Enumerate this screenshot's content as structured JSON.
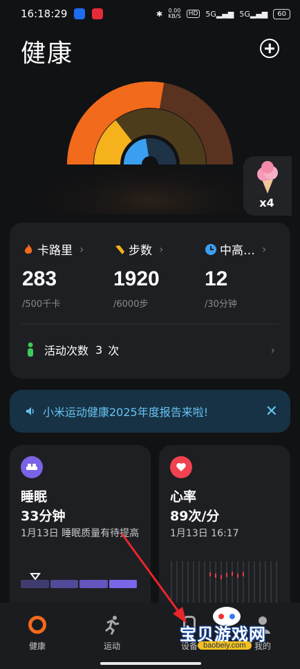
{
  "status_bar": {
    "time": "16:18:29",
    "net_speed_value": "0.00",
    "net_speed_unit": "KB/S",
    "hd_badge": "HD",
    "sig1": "5G",
    "sig2": "5G",
    "battery": "60"
  },
  "header": {
    "title": "健康"
  },
  "badge": {
    "count": "x4"
  },
  "stats": {
    "calories": {
      "label": "卡路里",
      "value": "283",
      "goal": "/500千卡"
    },
    "steps": {
      "label": "步数",
      "value": "1920",
      "goal": "/6000步"
    },
    "intensity": {
      "label": "中高…",
      "value": "12",
      "goal": "/30分钟"
    },
    "activity": {
      "label": "活动次数",
      "count": "3",
      "unit": "次"
    }
  },
  "banner": {
    "text": "小米运动健康2025年度报告来啦!"
  },
  "sleep": {
    "title": "睡眠",
    "value": "33分钟",
    "sub": "1月13日 睡眠质量有待提高"
  },
  "heart_rate": {
    "title": "心率",
    "value": "89次/分",
    "sub": "1月13日 16:17"
  },
  "nav": {
    "health": "健康",
    "workout": "运动",
    "devices": "设备",
    "mine": "我的"
  },
  "watermark": {
    "title": "宝贝游戏网",
    "url": "baobeiy.com"
  },
  "colors": {
    "calorie_ring": "#f26a1b",
    "steps_ring": "#f5b21c",
    "intensity_ring": "#3a9ff0",
    "banner_text": "#66c2f2",
    "sleep_icon": "#7a63e6",
    "heart_icon": "#f0424f"
  }
}
